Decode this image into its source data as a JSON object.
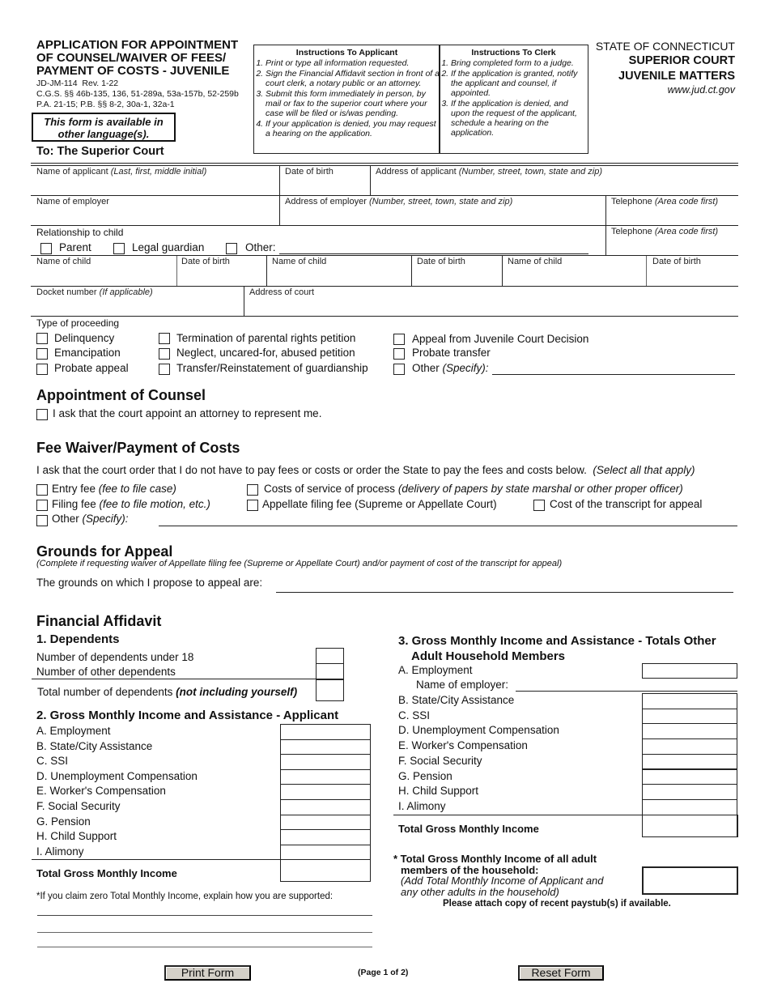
{
  "header": {
    "title_lines": [
      "APPLICATION FOR APPOINTMENT",
      "OF COUNSEL/WAIVER OF FEES/",
      "PAYMENT OF COSTS - JUVENILE"
    ],
    "form_number": "JD-JM-114  Rev. 1-22",
    "statutes_1": "C.G.S. §§ 46b-135, 136, 51-289a, 53a-157b, 52-259b",
    "statutes_2": "P.A. 21-15; P.B. §§ 8-2, 30a-1, 32a-1",
    "language_notice": [
      "This form is available in",
      "other language(s)."
    ],
    "to_line": "To: The Superior Court",
    "state": "STATE OF CONNECTICUT",
    "court": "SUPERIOR COURT",
    "division": "JUVENILE MATTERS",
    "website": "www.jud.ct.gov"
  },
  "instructions_applicant": {
    "title": "Instructions To Applicant",
    "items": [
      "Print or type all information requested.",
      "Sign the Financial Affidavit section in front of a court clerk, a notary public or an attorney.",
      "Submit this form immediately in person, by mail or fax to the superior court where your case will be filed or is/was pending.",
      "If your application is denied, you may request a hearing on the application."
    ]
  },
  "instructions_clerk": {
    "title": "Instructions To Clerk",
    "items": [
      "Bring completed form to a judge.",
      "If the application is granted, notify the applicant and counsel, if appointed.",
      "If the application is denied, and upon the request of the applicant, schedule a hearing on the application."
    ]
  },
  "fields": {
    "applicant_name": {
      "label": "Name of applicant",
      "hint": "(Last, first, middle initial)",
      "value": ""
    },
    "applicant_dob": {
      "label": "Date of birth",
      "value": ""
    },
    "applicant_address": {
      "label": "Address of applicant",
      "hint": "(Number, street, town, state and zip)",
      "value": ""
    },
    "employer_name": {
      "label": "Name of employer",
      "value": ""
    },
    "employer_address": {
      "label": "Address of employer",
      "hint": "(Number, street, town, state and zip)",
      "value": ""
    },
    "telephone_1": {
      "label": "Telephone",
      "hint": "(Area code first)",
      "value": ""
    },
    "relationship": {
      "label": "Relationship to child",
      "options": [
        "Parent",
        "Legal guardian",
        "Other:"
      ],
      "other_value": ""
    },
    "telephone_2": {
      "label": "Telephone",
      "hint": "(Area code first)",
      "value": ""
    },
    "children": [
      {
        "name_label": "Name of child",
        "dob_label": "Date of birth",
        "name": "",
        "dob": ""
      },
      {
        "name_label": "Name of child",
        "dob_label": "Date of birth",
        "name": "",
        "dob": ""
      },
      {
        "name_label": "Name of child",
        "dob_label": "Date of birth",
        "name": "",
        "dob": ""
      }
    ],
    "docket": {
      "label": "Docket number",
      "hint": "(If applicable)",
      "value": ""
    },
    "court_address": {
      "label": "Address of court",
      "value": ""
    }
  },
  "proceeding": {
    "label": "Type of proceeding",
    "col1": [
      "Delinquency",
      "Emancipation",
      "Probate appeal"
    ],
    "col2": [
      "Termination of parental rights petition",
      "Neglect, uncared-for, abused petition",
      "Transfer/Reinstatement of guardianship"
    ],
    "col3": [
      "Appeal from Juvenile Court Decision",
      "Probate transfer"
    ],
    "other_label": "Other",
    "other_hint": "(Specify):",
    "other_value": ""
  },
  "counsel": {
    "heading": "Appointment of Counsel",
    "request": "I ask that the court appoint an attorney to represent me."
  },
  "fees": {
    "heading": "Fee Waiver/Payment of Costs",
    "intro": "I ask that the court order that I do not have to pay fees or costs or order the State to pay the fees and costs below.",
    "intro_hint": "(Select all that apply)",
    "entry_fee": "Entry fee",
    "entry_fee_hint": "(fee to file case)",
    "filing_fee": "Filing fee",
    "filing_fee_hint": "(fee to file motion, etc.)",
    "other": "Other",
    "other_hint": "(Specify):",
    "other_value": "",
    "service": "Costs of service of process",
    "service_hint": "(delivery of papers by state marshal or other proper officer)",
    "appellate": "Appellate filing fee (Supreme or Appellate Court)",
    "transcript": "Cost of the transcript for appeal"
  },
  "appeal": {
    "heading": "Grounds for Appeal",
    "note": "(Complete if requesting waiver of Appellate filing fee (Supreme or Appellate Court) and/or payment of cost of the transcript for appeal)",
    "prompt": "The grounds on which I propose to appeal are:",
    "value": ""
  },
  "affidavit": {
    "heading": "Financial Affidavit",
    "dependents": {
      "heading": "1. Dependents",
      "under18": "Number of dependents under 18",
      "other": "Number of other dependents",
      "total": "Total number of dependents",
      "total_hint": "(not including yourself)"
    },
    "applicant_income": {
      "heading": "2. Gross Monthly Income and Assistance - Applicant",
      "items": [
        "A. Employment",
        "B. State/City Assistance",
        "C. SSI",
        "D. Unemployment Compensation",
        "E. Worker's Compensation",
        "F. Social Security",
        "G. Pension",
        "H. Child Support",
        "I.  Alimony"
      ],
      "total": "Total Gross Monthly Income"
    },
    "household_income": {
      "heading_1": "3. Gross Monthly Income and Assistance - Totals Other",
      "heading_2": "Adult Household Members",
      "employment": "A. Employment",
      "employer_name": "Name of employer:",
      "items": [
        "B. State/City Assistance",
        "C. SSI",
        "D. Unemployment Compensation",
        "E. Worker's Compensation",
        "F. Social Security",
        "G. Pension",
        "H. Child Support",
        "I.  Alimony"
      ],
      "total": "Total Gross Monthly Income"
    },
    "all_adults": {
      "line1": "* Total Gross Monthly Income of all adult",
      "line2": "members of the household:",
      "hint1": "(Add Total Monthly Income of Applicant and",
      "hint2": "any other adults in the household)",
      "paystub": "Please attach copy of recent paystub(s) if available."
    },
    "zero_income": "*If you claim zero Total Monthly Income, explain how you are supported:"
  },
  "footer": {
    "print": "Print Form",
    "page": "(Page 1 of 2)",
    "reset": "Reset Form"
  }
}
